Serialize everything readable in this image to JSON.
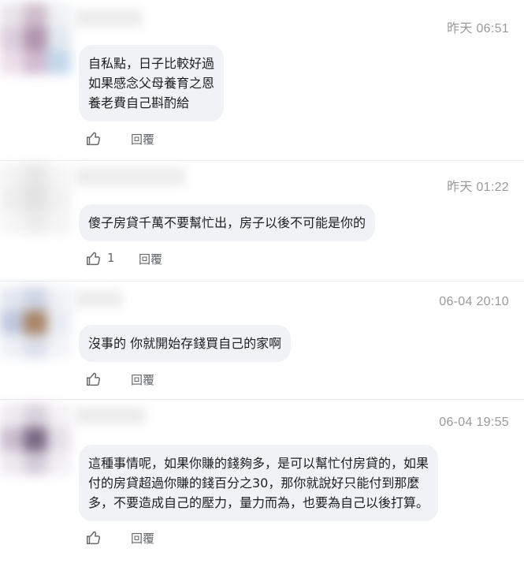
{
  "comments": [
    {
      "timestamp": "昨天 06:51",
      "lines": [
        "自私點，日子比較好過",
        "如果感念父母養育之恩",
        "養老費自己斟酌給"
      ],
      "like_count": "",
      "reply_label": "回覆",
      "avatar_colors": [
        "#e6e2e8",
        "#c9b6c6",
        "#eef0f2",
        "#d8c8d8",
        "#a98aa6",
        "#dfe6ee",
        "#eadbe6",
        "#cdb4cb",
        "#bcd3e8"
      ]
    },
    {
      "timestamp": "昨天 01:22",
      "lines": [
        "傻子房貸千萬不要幫忙出，房子以後不可能是你的"
      ],
      "like_count": "1",
      "reply_label": "回覆",
      "avatar_colors": [
        "#f2f2f2",
        "#e4e4e4",
        "#f4f4f4",
        "#ededed",
        "#e0e0e0",
        "#f0f0f0",
        "#f5f5f5",
        "#ebebeb",
        "#f3f3f3"
      ]
    },
    {
      "timestamp": "06-04 20:10",
      "lines": [
        "沒事的 你就開始存錢買自己的家啊"
      ],
      "like_count": "",
      "reply_label": "回覆",
      "avatar_colors": [
        "#dfe4ee",
        "#c8d0e2",
        "#eef0f4",
        "#b8c3dc",
        "#a07856",
        "#e6eaf2",
        "#eceff4",
        "#d6dbe8",
        "#f2f3f6"
      ]
    },
    {
      "timestamp": "06-04 19:55",
      "lines": [
        "這種事情呢，如果你賺的錢夠多，是可以幫忙付房貸的，如果",
        "付的房貸超過你賺的錢百分之30，那你就說好只能付到那麼",
        "多，不要造成自己的壓力，量力而為，也要為自己以後打算。"
      ],
      "like_count": "",
      "reply_label": "回覆",
      "avatar_colors": [
        "#ece8ee",
        "#d4ccd8",
        "#f2f0f3",
        "#c4b6c8",
        "#6e5a78",
        "#e2dce6",
        "#ebe7ed",
        "#cfc6d4",
        "#f0eef2"
      ]
    }
  ]
}
